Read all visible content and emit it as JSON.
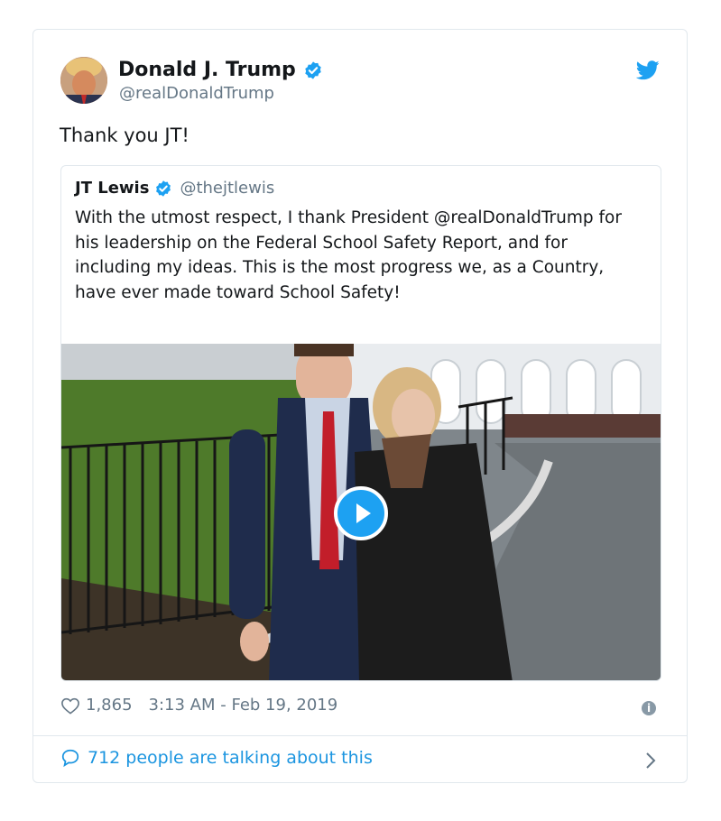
{
  "tweet": {
    "author": {
      "name": "Donald J. Trump",
      "handle": "@realDonaldTrump"
    },
    "text": "Thank you JT!",
    "likes": "1,865",
    "timestamp": "3:13 AM - Feb 19, 2019",
    "conversation": "712 people are talking about this"
  },
  "quoted": {
    "name": "JT Lewis",
    "handle": "@thejtlewis",
    "text": "With the utmost respect, I thank President @realDonaldTrump for his leadership on the Federal School Safety Report, and for including my ideas. This is the most progress we, as a Country, have ever made toward School Safety!"
  },
  "icons": {
    "verified": "verified-badge-icon",
    "brand": "twitter-bird-icon",
    "like": "heart-icon",
    "info": "info-icon",
    "reply": "speech-bubble-icon",
    "chevron": "chevron-right-icon",
    "play": "play-icon"
  },
  "colors": {
    "accent": "#1da1f2",
    "link": "#1b95e0",
    "muted": "#657786",
    "text": "#14171a",
    "border": "#e1e8ed"
  }
}
